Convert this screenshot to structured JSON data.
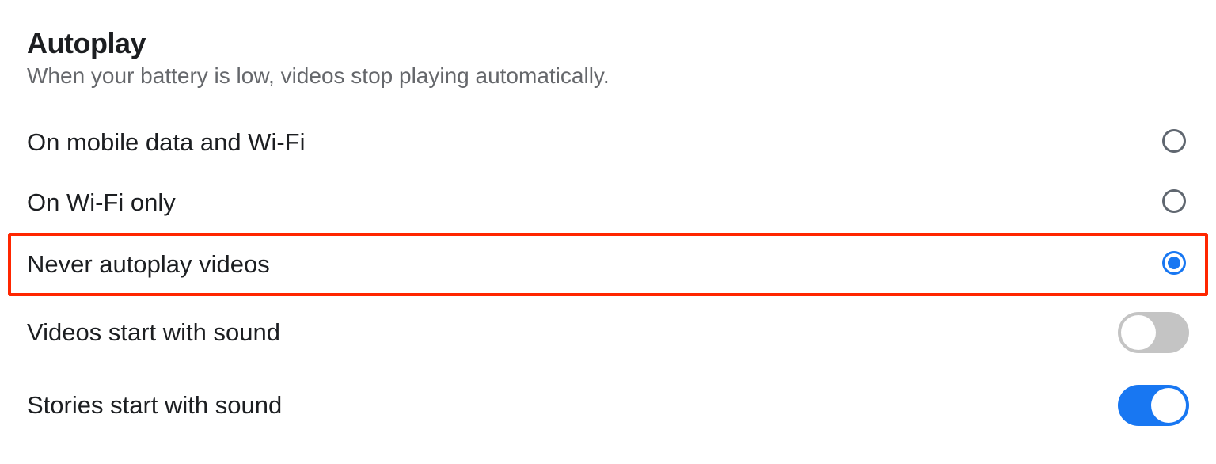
{
  "section": {
    "title": "Autoplay",
    "subtitle": "When your battery is low, videos stop playing automatically."
  },
  "options": {
    "mobile_wifi": {
      "label": "On mobile data and Wi-Fi",
      "selected": "false"
    },
    "wifi_only": {
      "label": "On Wi-Fi only",
      "selected": "false"
    },
    "never": {
      "label": "Never autoplay videos",
      "selected": "true"
    }
  },
  "toggles": {
    "videos_sound": {
      "label": "Videos start with sound",
      "on": "false"
    },
    "stories_sound": {
      "label": "Stories start with sound",
      "on": "true"
    }
  }
}
